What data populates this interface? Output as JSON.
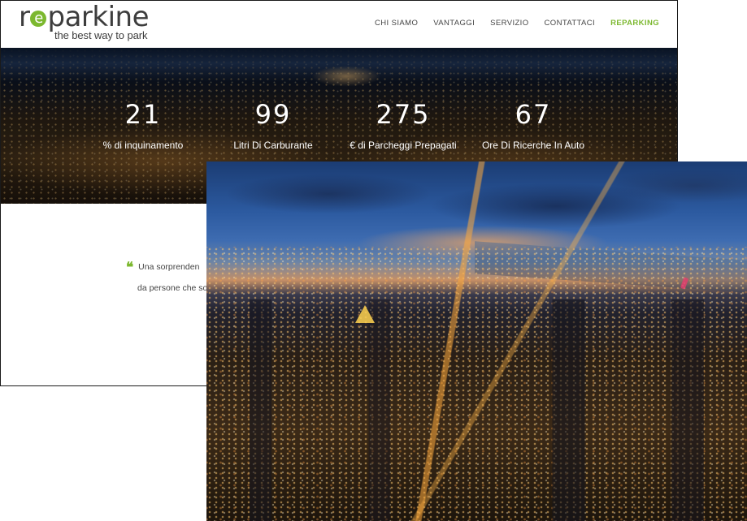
{
  "brand": {
    "logo_before_e": "r",
    "logo_e": "e",
    "logo_after_e": "parkine",
    "tagline": "the best way to park",
    "accent_color": "#7cb82f"
  },
  "nav": {
    "items": [
      {
        "label": "CHI SIAMO",
        "active": false
      },
      {
        "label": "VANTAGGI",
        "active": false
      },
      {
        "label": "SERVIZIO",
        "active": false
      },
      {
        "label": "CONTATTACI",
        "active": false
      },
      {
        "label": "REPARKING",
        "active": true
      }
    ]
  },
  "stats": [
    {
      "value": "21",
      "label": "% di inquinamento"
    },
    {
      "value": "99",
      "label": "Litri Di Carburante"
    },
    {
      "value": "275",
      "label": "€ di Parcheggi Prepagati"
    },
    {
      "value": "67",
      "label": "Ore Di Ricerche In Auto"
    }
  ],
  "quote": {
    "icon": "quote-icon",
    "line1": "Una sorprenden",
    "line2": "da persone che so"
  }
}
